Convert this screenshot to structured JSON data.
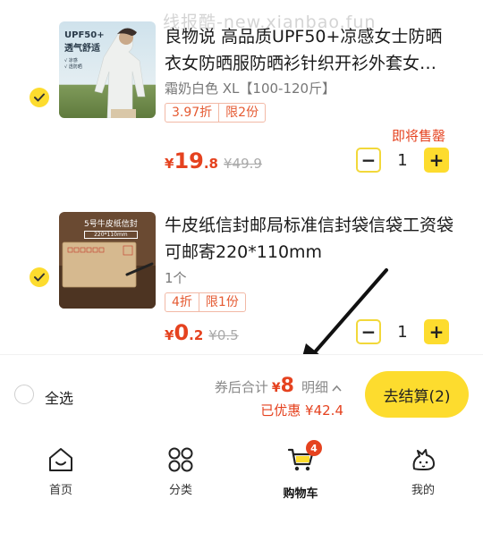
{
  "watermark": "线报酷-new.xianbao.fun",
  "items": [
    {
      "title": "良物说 高品质UPF50+凉感女士防晒衣女防晒服防晒衫针织开衫外套女…",
      "spec": "霜奶白色 XL【100-120斤】",
      "tags": [
        "3.97折",
        "限2份"
      ],
      "price_symbol": "¥",
      "price_int": "19",
      "price_dec": ".8",
      "old_price": "¥49.9",
      "status": "即将售罄",
      "quantity": "1",
      "selected": true,
      "thumb_text": [
        "UPF50+",
        "透气舒适",
        "√ 凉感",
        "√ 透防晒"
      ]
    },
    {
      "title": "牛皮纸信封邮局标准信封袋信袋工资袋可邮寄220*110mm",
      "spec": "1个",
      "tags": [
        "4折",
        "限1份"
      ],
      "price_symbol": "¥",
      "price_int": "0",
      "price_dec": ".2",
      "old_price": "¥0.5",
      "status": "",
      "quantity": "1",
      "selected": true,
      "thumb_text": [
        "5号牛皮纸信封",
        "220*110mm"
      ]
    }
  ],
  "stepper": {
    "minus": "−",
    "plus": "+"
  },
  "checkout": {
    "select_all": "全选",
    "total_label": "券后合计",
    "currency": "¥",
    "total": "8",
    "detail": "明细",
    "discount": "已优惠 ¥42.4",
    "pay_button": "去结算(2)"
  },
  "tabbar": {
    "tabs": [
      {
        "label": "首页",
        "icon": "home-icon"
      },
      {
        "label": "分类",
        "icon": "category-icon"
      },
      {
        "label": "购物车",
        "icon": "cart-icon",
        "badge": "4",
        "active": true
      },
      {
        "label": "我的",
        "icon": "profile-icon"
      }
    ]
  },
  "colors": {
    "accent": "#fddc2e",
    "price": "#e5421f",
    "tag_border": "#f2b9a6"
  }
}
